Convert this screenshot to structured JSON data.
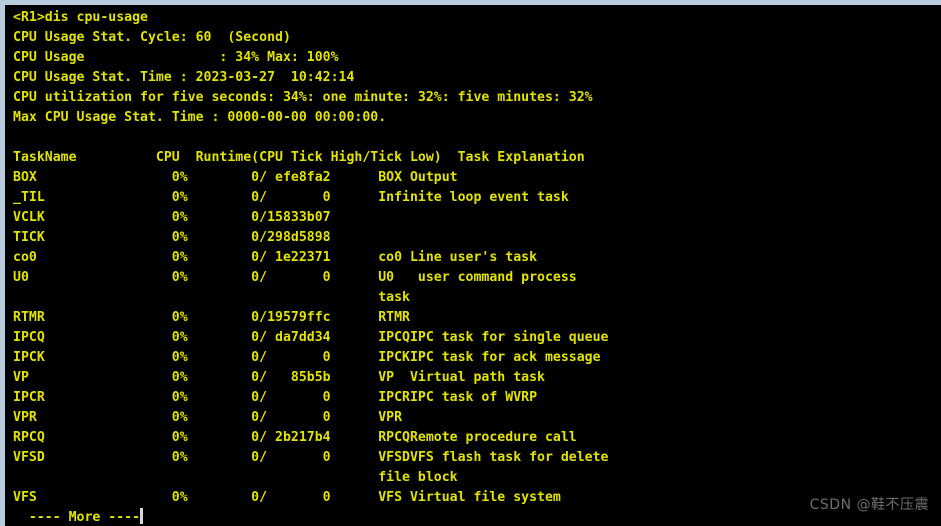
{
  "window": {
    "chrome_color": "#b9ccdd",
    "background_color": "#000000",
    "text_color": "#e3e300",
    "cursor_color": "#d8d8d8"
  },
  "terminal": {
    "prompt_line": "<R1>dis cpu-usage",
    "summary": {
      "stat_cycle": "CPU Usage Stat. Cycle: 60  (Second)",
      "usage": "CPU Usage                 : 34% Max: 100%",
      "stat_time": "CPU Usage Stat. Time : 2023-03-27  10:42:14",
      "utilization": "CPU utilization for five seconds: 34%: one minute: 32%: five minutes: 32%",
      "max_stat_time": "Max CPU Usage Stat. Time : 0000-00-00 00:00:00."
    },
    "values": {
      "cycle_seconds": "60",
      "cpu_usage_percent": "34%",
      "cpu_usage_max": "100%",
      "stat_date": "2023-03-27",
      "stat_clock": "10:42:14",
      "util_five_seconds": "34%",
      "util_one_minute": "32%",
      "util_five_minutes": "32%",
      "max_usage_date": "0000-00-00",
      "max_usage_clock": "00:00:00."
    },
    "table_header": "TaskName          CPU  Runtime(CPU Tick High/Tick Low)  Task Explanation",
    "columns": [
      "TaskName",
      "CPU",
      "Runtime(CPU Tick High/Tick Low)",
      "Task Explanation"
    ],
    "rows": [
      {
        "line": "BOX                 0%        0/ efe8fa2      BOX Output",
        "task": "BOX",
        "cpu": "0%",
        "runtime": "0/ efe8fa2",
        "explanation": "BOX Output"
      },
      {
        "line": "_TIL                0%        0/       0      Infinite loop event task",
        "task": "_TIL",
        "cpu": "0%",
        "runtime": "0/       0",
        "explanation": "Infinite loop event task"
      },
      {
        "line": "VCLK                0%        0/15833b07",
        "task": "VCLK",
        "cpu": "0%",
        "runtime": "0/15833b07",
        "explanation": ""
      },
      {
        "line": "TICK                0%        0/298d5898",
        "task": "TICK",
        "cpu": "0%",
        "runtime": "0/298d5898",
        "explanation": ""
      },
      {
        "line": "co0                 0%        0/ 1e22371      co0 Line user's task",
        "task": "co0",
        "cpu": "0%",
        "runtime": "0/ 1e22371",
        "explanation": "co0 Line user's task"
      },
      {
        "line": "U0                  0%        0/       0      U0   user command process",
        "task": "U0",
        "cpu": "0%",
        "runtime": "0/       0",
        "explanation": "U0   user command process"
      },
      {
        "line": "                                              task",
        "task": "",
        "cpu": "",
        "runtime": "",
        "explanation": "task"
      },
      {
        "line": "RTMR                0%        0/19579ffc      RTMR",
        "task": "RTMR",
        "cpu": "0%",
        "runtime": "0/19579ffc",
        "explanation": "RTMR"
      },
      {
        "line": "IPCQ                0%        0/ da7dd34      IPCQIPC task for single queue",
        "task": "IPCQ",
        "cpu": "0%",
        "runtime": "0/ da7dd34",
        "explanation": "IPCQIPC task for single queue"
      },
      {
        "line": "IPCK                0%        0/       0      IPCKIPC task for ack message",
        "task": "IPCK",
        "cpu": "0%",
        "runtime": "0/       0",
        "explanation": "IPCKIPC task for ack message"
      },
      {
        "line": "VP                  0%        0/   85b5b      VP  Virtual path task",
        "task": "VP",
        "cpu": "0%",
        "runtime": "0/   85b5b",
        "explanation": "VP  Virtual path task"
      },
      {
        "line": "IPCR                0%        0/       0      IPCRIPC task of WVRP",
        "task": "IPCR",
        "cpu": "0%",
        "runtime": "0/       0",
        "explanation": "IPCRIPC task of WVRP"
      },
      {
        "line": "VPR                 0%        0/       0      VPR",
        "task": "VPR",
        "cpu": "0%",
        "runtime": "0/       0",
        "explanation": "VPR"
      },
      {
        "line": "RPCQ                0%        0/ 2b217b4      RPCQRemote procedure call",
        "task": "RPCQ",
        "cpu": "0%",
        "runtime": "0/ 2b217b4",
        "explanation": "RPCQRemote procedure call"
      },
      {
        "line": "VFSD                0%        0/       0      VFSDVFS flash task for delete",
        "task": "VFSD",
        "cpu": "0%",
        "runtime": "0/       0",
        "explanation": "VFSDVFS flash task for delete"
      },
      {
        "line": "                                              file block",
        "task": "",
        "cpu": "",
        "runtime": "",
        "explanation": "file block"
      },
      {
        "line": "VFS                 0%        0/       0      VFS Virtual file system",
        "task": "VFS",
        "cpu": "0%",
        "runtime": "0/       0",
        "explanation": "VFS Virtual file system"
      }
    ],
    "more_prompt": "  ---- More ----"
  },
  "watermark": {
    "text": "CSDN @鞋不压震"
  }
}
